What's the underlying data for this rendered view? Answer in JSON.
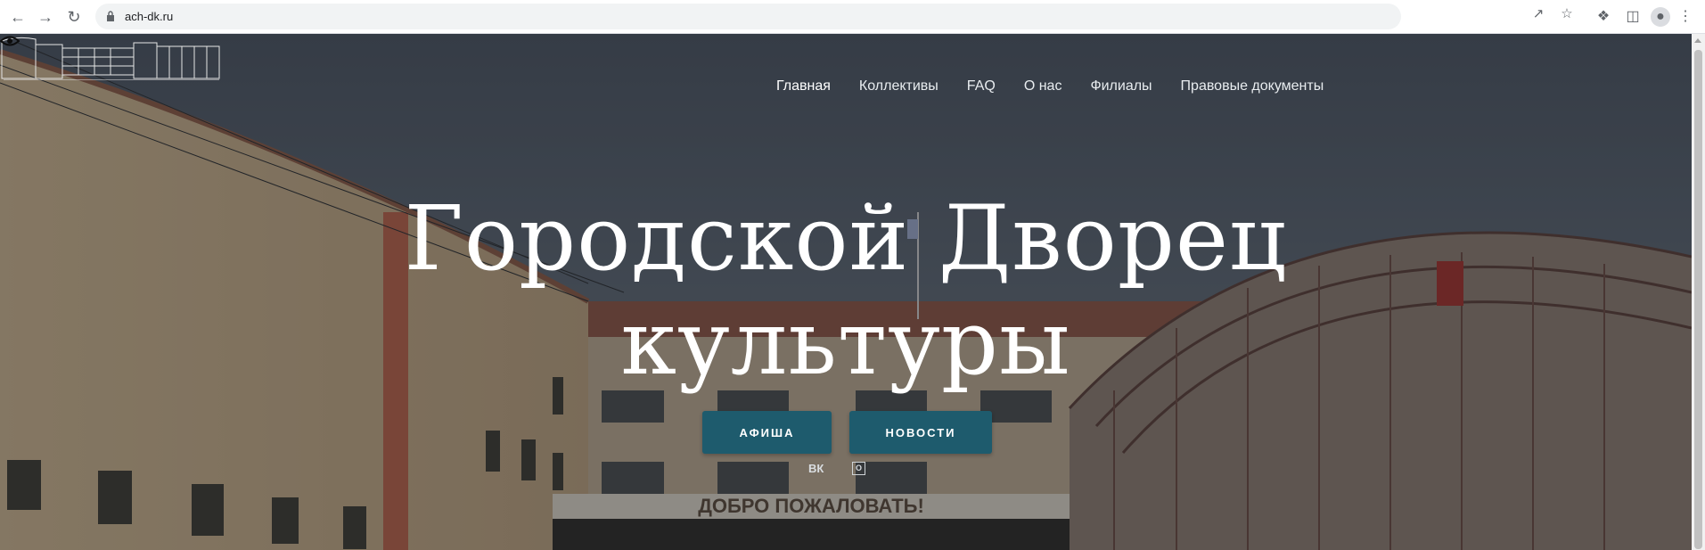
{
  "browser": {
    "url": "ach-dk.ru"
  },
  "site": {
    "nav": [
      {
        "label": "Главная",
        "active": true
      },
      {
        "label": "Коллективы",
        "active": false
      },
      {
        "label": "FAQ",
        "active": false
      },
      {
        "label": "О нас",
        "active": false
      },
      {
        "label": "Филиалы",
        "active": false
      },
      {
        "label": "Правовые документы",
        "active": false
      }
    ],
    "accessibility_icon": "eye-icon",
    "hero": {
      "title_line1": "Городской Дворец",
      "title_line2": "культуры",
      "buttons": {
        "afisha": "АФИША",
        "news": "НОВОСТИ"
      },
      "social": {
        "vk": "vk",
        "ok": "ok"
      },
      "banner_text": "ДОБРО ПОЖАЛОВАТЬ!"
    }
  },
  "colors": {
    "button_bg": "#1e5b6d",
    "overlay": "rgba(20,24,30,0.38)"
  }
}
